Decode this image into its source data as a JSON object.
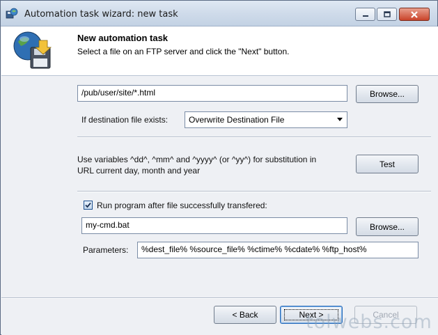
{
  "window": {
    "title": "Automation task wizard: new task",
    "icon": "app-wizard-icon",
    "buttons": {
      "minimize": "minimize-icon",
      "maximize": "maximize-icon",
      "close": "close-icon"
    }
  },
  "header": {
    "title": "New automation task",
    "subtitle": "Select a file on an FTP server and click the \"Next\" button.",
    "icon": "globe-ftp-floppy-icon"
  },
  "form": {
    "remote_path": "/pub/user/site/*.html",
    "browse_label": "Browse...",
    "dest_exists_label": "If destination file exists:",
    "dest_exists_value": "Overwrite Destination File",
    "variables_text_line1": "Use variables ^dd^, ^mm^ and ^yyyy^ (or ^yy^) for substitution in",
    "variables_text_line2": "URL current day, month and year",
    "test_label": "Test",
    "run_program_checked": true,
    "run_program_label": "Run program after file successfully transfered:",
    "program_path": "my-cmd.bat",
    "browse2_label": "Browse...",
    "parameters_label": "Parameters:",
    "parameters_value": "%dest_file% %source_file% %ctime% %cdate% %ftp_host%"
  },
  "footer": {
    "back_label": "< Back",
    "next_label": "Next >",
    "cancel_label": "Cancel"
  },
  "watermark": "tolwebs.com",
  "colors": {
    "window_bg": "#eef0f4",
    "title_bar": "#cfdbea",
    "close_red": "#c9432a",
    "border_blue": "#7a8ca5"
  }
}
